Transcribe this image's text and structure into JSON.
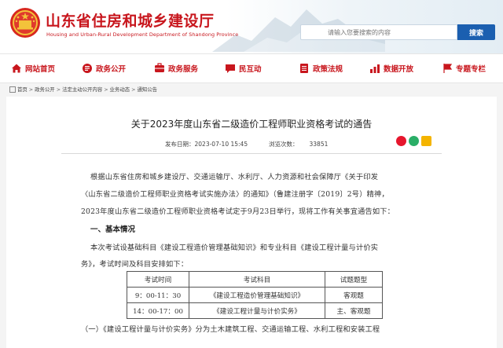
{
  "header": {
    "title": "山东省住房和城乡建设厅",
    "subtitle": "Housing and Urban-Rural Development Department of Shandong Province",
    "search_placeholder": "请输入您要搜索的内容",
    "search_button": "搜索",
    "brand_color": "#c8161d",
    "accent_color": "#1b5fb0"
  },
  "nav": [
    {
      "label": "网站首页",
      "icon": "home-icon"
    },
    {
      "label": "政务公开",
      "icon": "document-icon"
    },
    {
      "label": "政务服务",
      "icon": "service-icon"
    },
    {
      "label": "民互动",
      "icon": "chat-icon"
    },
    {
      "label": "政策法规",
      "icon": "law-icon"
    },
    {
      "label": "数据开放",
      "icon": "data-icon"
    },
    {
      "label": "专题专栏",
      "icon": "topic-icon"
    }
  ],
  "breadcrumb": [
    "首页",
    "政务公开",
    "法定主动公开内容",
    "业务动态",
    "通知公告"
  ],
  "article": {
    "title": "关于2023年度山东省二级造价工程师职业资格考试的通告",
    "publish_label": "发布日期：",
    "publish_date": "2023-07-10 15:45",
    "views_label": "浏览次数：",
    "views": "33851",
    "para1_line1": "根据山东省住房和城乡建设厅、交通运输厅、水利厅、人力资源和社会保障厅《关于印发",
    "para1_line2": "〈山东省二级造价工程师职业资格考试实施办法〉的通知》（鲁建注册字〔2019〕2号）精神，",
    "para1_line3": "2023年度山东省二级造价工程师职业资格考试定于9月23日举行，现将工作有关事宜通告如下：",
    "section1": "一、基本情况",
    "para2_line1": "本次考试设基础科目《建设工程造价管理基础知识》和专业科目《建设工程计量与计价实",
    "para2_line2": "务》，考试时间及科目安排如下：",
    "para3_line1": "（一）《建设工程计量与计价实务》分为土木建筑工程、交通运输工程、水利工程和安装工程"
  },
  "exam_table": {
    "headers": [
      "考试时间",
      "考试科目",
      "试题题型"
    ],
    "rows": [
      [
        "9：00-11：30",
        "《建设工程造价管理基础知识》",
        "客观题"
      ],
      [
        "14：00-17：00",
        "《建设工程计量与计价实务》",
        "主、客观题"
      ]
    ]
  }
}
